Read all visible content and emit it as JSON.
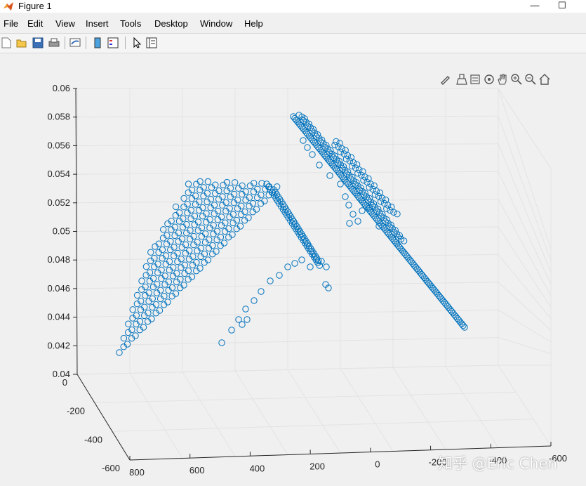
{
  "window": {
    "title": "Figure 1",
    "minimize": "—",
    "maximize": "☐"
  },
  "menu": [
    "File",
    "Edit",
    "View",
    "Insert",
    "Tools",
    "Desktop",
    "Window",
    "Help"
  ],
  "toolbar_icons": [
    "new-figure-icon",
    "open-file-icon",
    "save-icon",
    "print-icon",
    "link-plot-icon",
    "colorbar-icon",
    "legend-icon",
    "select-arrow-icon",
    "property-inspector-icon"
  ],
  "axes_toolbar_icons": [
    "edit-plot-icon",
    "brush-icon",
    "data-tips-icon",
    "rotate-3d-icon",
    "pan-icon",
    "zoom-in-icon",
    "zoom-out-icon",
    "home-icon"
  ],
  "colors": {
    "marker": "#0072BD",
    "grid": "#e3e3e3",
    "axis": "#262626"
  },
  "chart_data": {
    "type": "scatter",
    "marker": "circle",
    "z_ticks": [
      "0.04",
      "0.042",
      "0.044",
      "0.046",
      "0.048",
      "0.05",
      "0.052",
      "0.054",
      "0.056",
      "0.058",
      "0.06"
    ],
    "y_ticks": [
      "0",
      "-200",
      "-400",
      "-600"
    ],
    "x_ticks": [
      "800",
      "600",
      "400",
      "200",
      "0",
      "-200",
      "-400",
      "-600"
    ],
    "zlim": [
      0.04,
      0.06
    ],
    "grid": true,
    "series": [
      {
        "segments": [
          [
            0.042,
            0.051
          ],
          [
            0.0422,
            0.0512
          ],
          [
            0.0424,
            0.0515
          ],
          [
            0.0427,
            0.0517
          ],
          [
            0.043,
            0.0519
          ],
          [
            0.0433,
            0.0521
          ],
          [
            0.0435,
            0.0523
          ],
          [
            0.0438,
            0.0525
          ],
          [
            0.044,
            0.0528
          ],
          [
            0.0443,
            0.053
          ],
          [
            0.0445,
            0.0532
          ],
          [
            0.0448,
            0.0534
          ],
          [
            0.045,
            0.0536
          ],
          [
            0.0453,
            0.0538
          ]
        ]
      },
      {
        "segments": [
          [
            0.058,
            0.044
          ]
        ]
      }
    ]
  },
  "watermark": "知乎 @Eric Chen"
}
